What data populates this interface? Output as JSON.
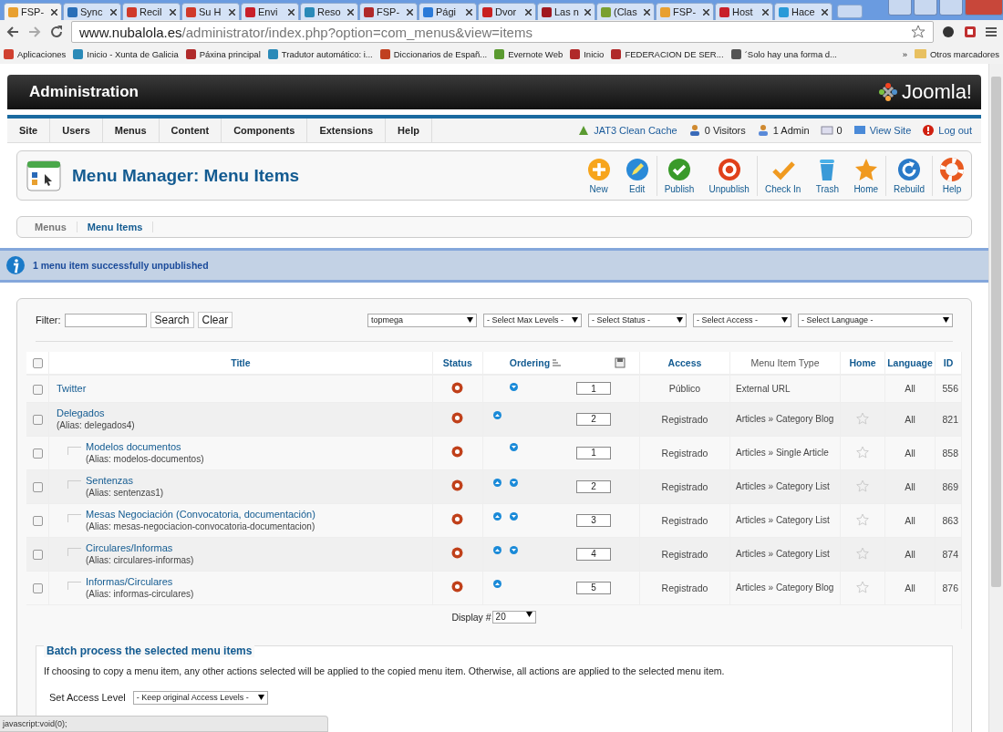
{
  "browser": {
    "tabs": [
      {
        "label": "FSP-",
        "selected": true,
        "color": "#e8a030"
      },
      {
        "label": "Sync",
        "selected": false,
        "color": "#2a6fb8"
      },
      {
        "label": "Recil",
        "selected": false,
        "color": "#d03a2a"
      },
      {
        "label": "Su H",
        "selected": false,
        "color": "#d03a2a"
      },
      {
        "label": "Envi",
        "selected": false,
        "color": "#c8202a"
      },
      {
        "label": "Reso",
        "selected": false,
        "color": "#2a8ab8"
      },
      {
        "label": "FSP-",
        "selected": false,
        "color": "#b02a2a"
      },
      {
        "label": "Pági",
        "selected": false,
        "color": "#2a7ad8"
      },
      {
        "label": "Dvor",
        "selected": false,
        "color": "#c82020"
      },
      {
        "label": "Las n",
        "selected": false,
        "color": "#a01820"
      },
      {
        "label": "(Clas",
        "selected": false,
        "color": "#7aa030"
      },
      {
        "label": "FSP-",
        "selected": false,
        "color": "#e8a030"
      },
      {
        "label": "Host",
        "selected": false,
        "color": "#c8202a"
      },
      {
        "label": "Hace",
        "selected": false,
        "color": "#2a9ad8"
      }
    ],
    "address": {
      "host": "www.nubalola.es",
      "path": "/administrator/index.php?option=com_menus&view=items"
    },
    "bookmarks": [
      {
        "label": "Aplicaciones",
        "color": "#d04030"
      },
      {
        "label": "Inicio - Xunta de Galicia",
        "color": "#2a8ab8"
      },
      {
        "label": "Páxina principal",
        "color": "#b02a2a"
      },
      {
        "label": "Tradutor automático: i...",
        "color": "#2a8ab8"
      },
      {
        "label": "Diccionarios de Españ...",
        "color": "#c04020"
      },
      {
        "label": "Evernote Web",
        "color": "#5a9a30"
      },
      {
        "label": "Inicio",
        "color": "#b02a2a"
      },
      {
        "label": "FEDERACION DE SER...",
        "color": "#b02a2a"
      },
      {
        "label": "´Solo hay una forma d...",
        "color": "#555555"
      }
    ],
    "bookmarks_more": "»",
    "other_bookmarks": "Otros marcadores",
    "status_text": "javascript:void(0);"
  },
  "header": {
    "title": "Administration",
    "logo": "Joomla!"
  },
  "menu": [
    "Site",
    "Users",
    "Menus",
    "Content",
    "Components",
    "Extensions",
    "Help"
  ],
  "status_links": [
    {
      "kind": "cache",
      "label": "JAT3 Clean Cache"
    },
    {
      "kind": "visitors",
      "label": "0 Visitors"
    },
    {
      "kind": "admin",
      "label": "1 Admin"
    },
    {
      "kind": "messages",
      "label": "0"
    },
    {
      "kind": "site",
      "label": "View Site"
    },
    {
      "kind": "logout",
      "label": "Log out"
    }
  ],
  "page_title": "Menu Manager: Menu Items",
  "toolbar": [
    {
      "kind": "new",
      "label": "New",
      "separator_after": false
    },
    {
      "kind": "edit",
      "label": "Edit",
      "separator_after": true
    },
    {
      "kind": "publish",
      "label": "Publish",
      "separator_after": false
    },
    {
      "kind": "unpublish",
      "label": "Unpublish",
      "separator_after": true
    },
    {
      "kind": "checkin",
      "label": "Check In",
      "separator_after": false
    },
    {
      "kind": "trash",
      "label": "Trash",
      "separator_after": false
    },
    {
      "kind": "home",
      "label": "Home",
      "separator_after": true
    },
    {
      "kind": "rebuild",
      "label": "Rebuild",
      "separator_after": true
    },
    {
      "kind": "help",
      "label": "Help",
      "separator_after": false
    }
  ],
  "submenu": [
    {
      "label": "Menus",
      "selected": false
    },
    {
      "label": "Menu Items",
      "selected": true
    }
  ],
  "message": "1 menu item successfully unpublished",
  "filters": {
    "label": "Filter:",
    "search_button": "Search",
    "clear_button": "Clear",
    "selects": [
      "topmega",
      "- Select Max Levels -",
      "- Select Status -",
      "- Select Access -",
      "- Select Language -"
    ]
  },
  "table": {
    "select_all_checked": false,
    "columns": [
      "Title",
      "Status",
      "Ordering",
      "Access",
      "Menu Item Type",
      "Home",
      "Language",
      "ID"
    ],
    "rows": [
      {
        "title": "Twitter",
        "checked": false,
        "published": false,
        "move_up": false,
        "move_down": true,
        "order": "1",
        "access": "Público",
        "type": "External URL",
        "home_star": false,
        "language": "All",
        "id": "556"
      },
      {
        "title": "Delegados",
        "alias": "(Alias: delegados4)",
        "checked": false,
        "published": false,
        "move_up": true,
        "move_down": false,
        "order": "2",
        "access": "Registrado",
        "type": "Articles » Category Blog",
        "home_star": true,
        "language": "All",
        "id": "821",
        "children": [
          {
            "title": "Modelos documentos",
            "alias": "(Alias: modelos-documentos)",
            "checked": false,
            "published": false,
            "move_up": false,
            "move_down": true,
            "order": "1",
            "access": "Registrado",
            "type": "Articles » Single Article",
            "home_star": true,
            "language": "All",
            "id": "858"
          },
          {
            "title": "Sentenzas",
            "alias": "(Alias: sentenzas1)",
            "checked": false,
            "published": false,
            "move_up": true,
            "move_down": true,
            "order": "2",
            "access": "Registrado",
            "type": "Articles » Category List",
            "home_star": true,
            "language": "All",
            "id": "869"
          },
          {
            "title": "Mesas Negociación (Convocatoria, documentación)",
            "alias": "(Alias: mesas-negociacion-convocatoria-documentacion)",
            "checked": false,
            "published": false,
            "move_up": true,
            "move_down": true,
            "order": "3",
            "access": "Registrado",
            "type": "Articles » Category List",
            "home_star": true,
            "language": "All",
            "id": "863"
          },
          {
            "title": "Circulares/Informas",
            "alias": "(Alias: circulares-informas)",
            "checked": false,
            "published": false,
            "move_up": true,
            "move_down": true,
            "order": "4",
            "access": "Registrado",
            "type": "Articles » Category List",
            "home_star": true,
            "language": "All",
            "id": "874"
          },
          {
            "title": "Informas/Circulares",
            "alias": "(Alias: informas-circulares)",
            "checked": false,
            "published": false,
            "move_up": true,
            "move_down": false,
            "order": "5",
            "access": "Registrado",
            "type": "Articles » Category Blog",
            "home_star": true,
            "language": "All",
            "id": "876"
          }
        ]
      }
    ],
    "display_label": "Display #",
    "display_value": "20"
  },
  "batch": {
    "legend": "Batch process the selected menu items",
    "description": "If choosing to copy a menu item, any other actions selected will be applied to the copied menu item. Otherwise, all actions are applied to the selected menu item.",
    "access_label": "Set Access Level",
    "access_select": "- Keep original Access Levels -"
  }
}
